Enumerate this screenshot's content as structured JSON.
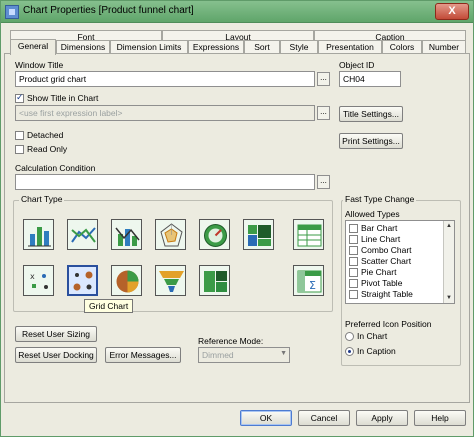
{
  "window": {
    "title": "Chart Properties [Product funnel chart]",
    "close_label": "X"
  },
  "tabs_top": [
    "Font",
    "Layout",
    "Caption"
  ],
  "tabs_bottom": [
    "General",
    "Dimensions",
    "Dimension Limits",
    "Expressions",
    "Sort",
    "Style",
    "Presentation",
    "Colors",
    "Number"
  ],
  "general": {
    "window_title_label": "Window Title",
    "window_title_value": "Product grid chart",
    "object_id_label": "Object ID",
    "object_id_value": "CH04",
    "show_title_label": "Show Title in Chart",
    "title_expression_placeholder": "<use first expression label>",
    "title_settings_label": "Title Settings...",
    "print_settings_label": "Print Settings...",
    "detached_label": "Detached",
    "read_only_label": "Read Only",
    "calc_condition_label": "Calculation Condition",
    "calc_condition_value": "",
    "dots": "..."
  },
  "chart_type": {
    "label": "Chart Type",
    "tooltip": "Grid Chart",
    "icons": [
      "bar-chart-icon",
      "line-chart-icon",
      "combo-chart-icon",
      "radar-chart-icon",
      "gauge-chart-icon",
      "mekko-chart-icon",
      "straight-table-icon",
      "scatter-chart-icon",
      "grid-chart-icon",
      "pie-chart-icon",
      "funnel-chart-icon",
      "block-chart-icon",
      "pivot-table-icon"
    ]
  },
  "fast_type": {
    "label": "Fast Type Change",
    "allowed_label": "Allowed Types",
    "items": [
      "Bar Chart",
      "Line Chart",
      "Combo Chart",
      "Scatter Chart",
      "Pie Chart",
      "Pivot Table",
      "Straight Table"
    ],
    "pref_icon_label": "Preferred Icon Position",
    "in_chart_label": "In Chart",
    "in_caption_label": "In Caption"
  },
  "buttons": {
    "reset_user_sizing": "Reset User Sizing",
    "reset_user_docking": "Reset User Docking",
    "error_messages": "Error Messages...",
    "reference_mode_label": "Reference Mode:",
    "reference_mode_value": "Dimmed",
    "ok": "OK",
    "cancel": "Cancel",
    "apply": "Apply",
    "help": "Help"
  }
}
